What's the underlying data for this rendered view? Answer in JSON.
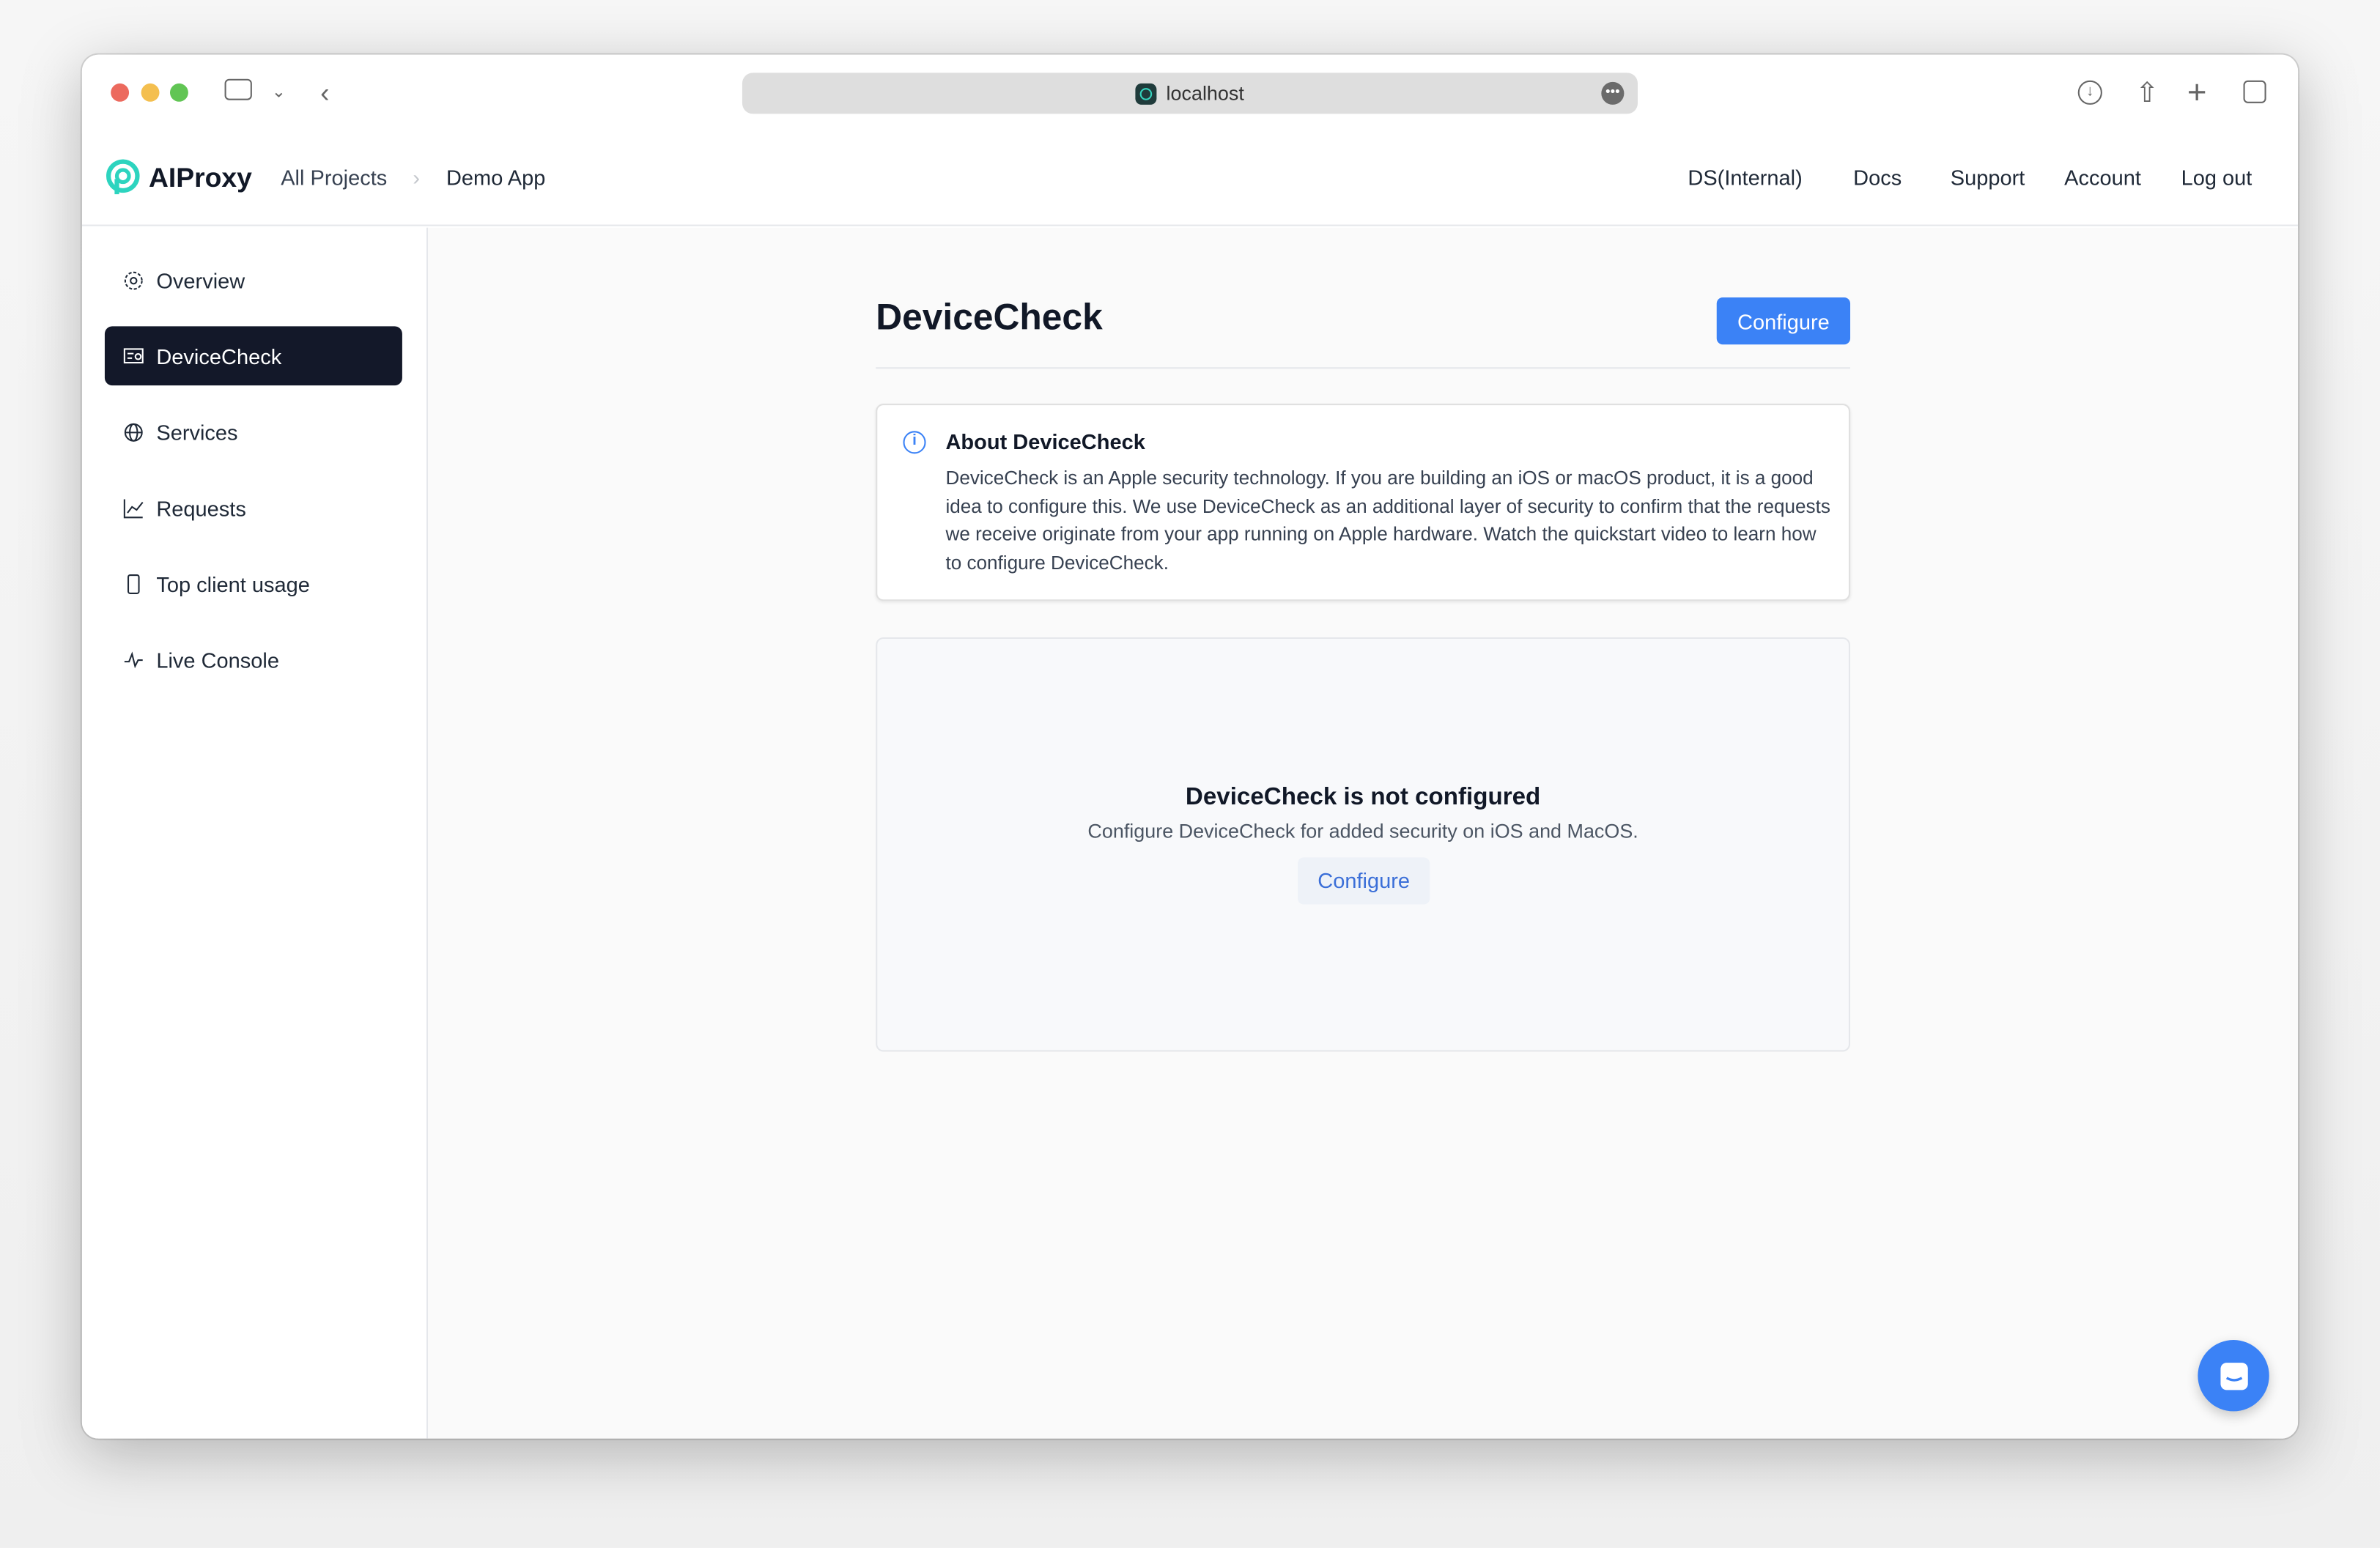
{
  "browser": {
    "url": "localhost",
    "icons": [
      "sidebar-toggle-icon",
      "chevron-down-icon",
      "back-icon",
      "download-icon",
      "share-icon",
      "new-tab-icon",
      "tabs-overview-icon"
    ]
  },
  "header": {
    "brand": "AIProxy",
    "breadcrumb": [
      "All Projects",
      "Demo App"
    ],
    "nav": [
      "DS(Internal)",
      "Docs",
      "Support",
      "Account",
      "Log out"
    ]
  },
  "sidebar": {
    "items": [
      {
        "label": "Overview",
        "icon": "gear-icon"
      },
      {
        "label": "DeviceCheck",
        "icon": "certificate-icon",
        "active": true
      },
      {
        "label": "Services",
        "icon": "globe-icon"
      },
      {
        "label": "Requests",
        "icon": "chart-icon"
      },
      {
        "label": "Top client usage",
        "icon": "phone-icon"
      },
      {
        "label": "Live Console",
        "icon": "activity-icon"
      }
    ]
  },
  "main": {
    "title": "DeviceCheck",
    "configure_label": "Configure",
    "about": {
      "title": "About DeviceCheck",
      "body": "DeviceCheck is an Apple security technology. If you are building an iOS or macOS product, it is a good idea to configure this. We use DeviceCheck as an additional layer of security to confirm that the requests we receive originate from your app running on Apple hardware. Watch the quickstart video to learn how to configure DeviceCheck."
    },
    "empty": {
      "title": "DeviceCheck is not configured",
      "subtitle": "Configure DeviceCheck for added security on iOS and MacOS.",
      "button": "Configure"
    }
  },
  "colors": {
    "accent": "#3b82f6",
    "active_nav": "#131829",
    "brand": "#2dd4bf"
  }
}
